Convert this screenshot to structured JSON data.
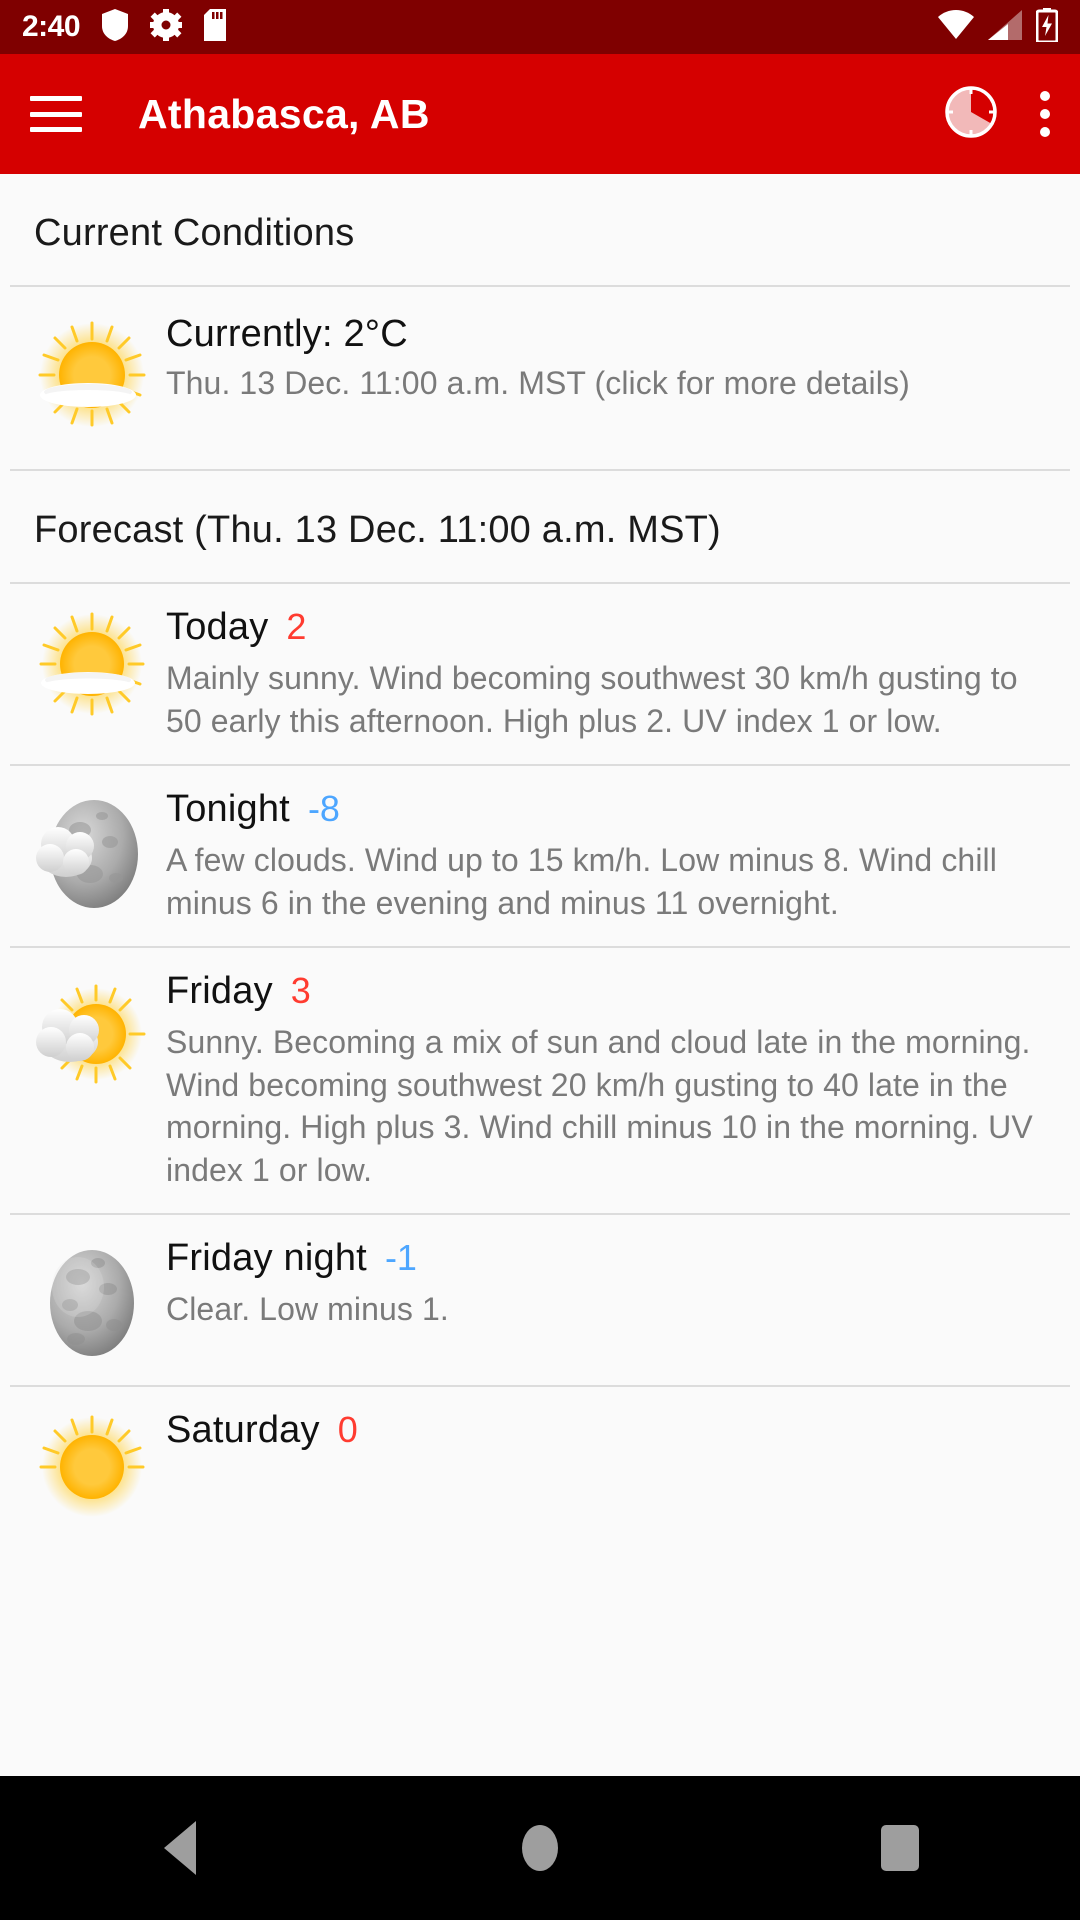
{
  "status_bar": {
    "time": "2:40",
    "icons_left": [
      "shield-icon",
      "gear-icon",
      "sd-card-icon"
    ],
    "icons_right": [
      "wifi-icon",
      "cell-signal-icon",
      "battery-charging-icon"
    ],
    "background_color": "#7f0000"
  },
  "app_bar": {
    "menu_icon": "hamburger-menu-icon",
    "title": "Athabasca, AB",
    "radar_icon": "radar-pie-icon",
    "overflow_icon": "overflow-menu-icon",
    "background_color": "#d50000"
  },
  "current_conditions": {
    "section_title": "Current Conditions",
    "icon": "sun-behind-haze-icon",
    "temperature_line": "Currently: 2°C",
    "timestamp_line": "Thu. 13 Dec. 11:00 a.m. MST (click for more details)"
  },
  "forecast": {
    "section_title": "Forecast (Thu. 13 Dec. 11:00 a.m. MST)",
    "items": [
      {
        "icon": "sun-behind-haze-icon",
        "period": "Today",
        "temperature": "2",
        "temp_kind": "warm",
        "description": "Mainly sunny. Wind becoming southwest 30 km/h gusting to 50 early this afternoon. High plus 2. UV index 1 or low."
      },
      {
        "icon": "moon-behind-cloud-icon",
        "period": "Tonight",
        "temperature": "-8",
        "temp_kind": "cold",
        "description": "A few clouds. Wind up to 15 km/h. Low minus 8. Wind chill minus 6 in the evening and minus 11 overnight."
      },
      {
        "icon": "sun-behind-cloud-icon",
        "period": "Friday",
        "temperature": "3",
        "temp_kind": "warm",
        "description": "Sunny. Becoming a mix of sun and cloud late in the morning. Wind becoming southwest 20 km/h gusting to 40 late in the morning. High plus 3. Wind chill minus 10 in the morning. UV index 1 or low."
      },
      {
        "icon": "moon-icon",
        "period": "Friday night",
        "temperature": "-1",
        "temp_kind": "cold",
        "description": "Clear. Low minus 1."
      },
      {
        "icon": "sun-behind-haze-icon",
        "period": "Saturday",
        "temperature": "0",
        "temp_kind": "warm",
        "description": ""
      }
    ]
  },
  "nav_bar": {
    "back": "back-navigation-icon",
    "home": "home-navigation-icon",
    "recents": "recent-apps-icon"
  },
  "colors": {
    "warm_temp": "#ff3b30",
    "cold_temp": "#4da6ff",
    "accent": "#d50000"
  }
}
